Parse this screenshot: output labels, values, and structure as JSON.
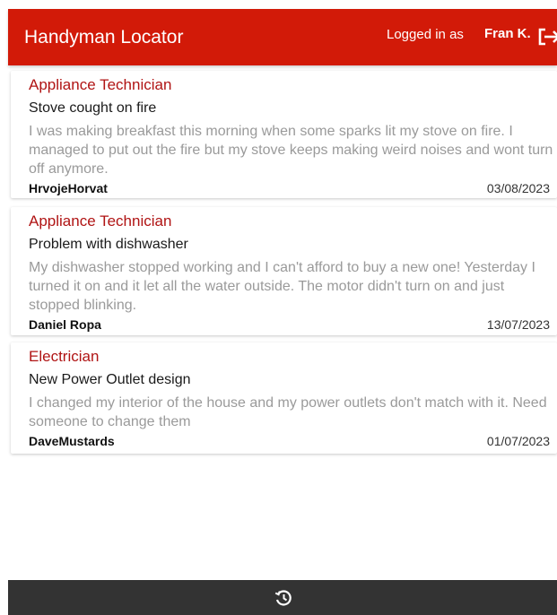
{
  "header": {
    "title": "Handyman Locator",
    "logged_in_label": "Logged in as",
    "user_name": "Fran K.",
    "logout_icon": "logout-icon"
  },
  "posts": [
    {
      "category": "Appliance Technician",
      "title": "Stove cought on fire",
      "description": "I was making breakfast this morning when some sparks lit my stove on fire.  I managed to put out the fire but my stove keeps making weird noises and wont turn off anymore.",
      "author": "HrvojeHorvat",
      "date": "03/08/2023"
    },
    {
      "category": "Appliance Technician",
      "title": "Problem with dishwasher",
      "description": "My dishwasher stopped working and I can't afford to buy a new one! Yesterday I turned it on and it let all the water outside. The motor didn't turn on and just stopped blinking.",
      "author": "Daniel Ropa",
      "date": "13/07/2023"
    },
    {
      "category": "Electrician",
      "title": "New Power Outlet design",
      "description": "I changed my interior of the house and my power outlets don't match with it. Need someone to change them",
      "author": "DaveMustards",
      "date": "01/07/2023"
    }
  ],
  "footer": {
    "history_icon": "history-icon"
  },
  "colors": {
    "header_bg": "#d21a08",
    "category_text": "#b01414",
    "description_text": "#9a9a9a",
    "footer_bg": "#333333"
  }
}
